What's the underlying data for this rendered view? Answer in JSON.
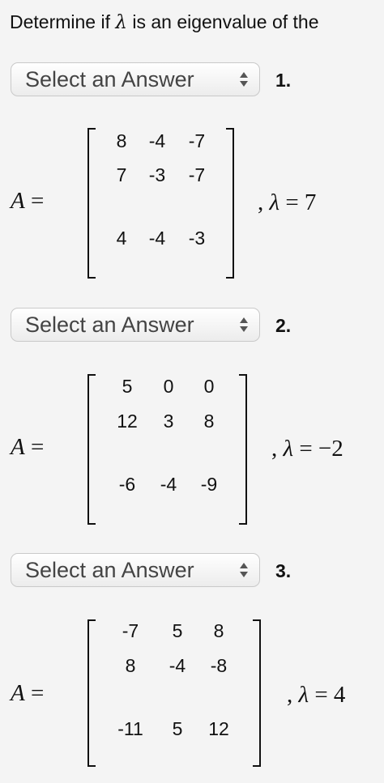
{
  "header": {
    "prefix": "Determine if ",
    "lambda": "λ",
    "suffix": " is an eigenvalue of the"
  },
  "problems": [
    {
      "select_value": "Select an Answer",
      "number": "1.",
      "a_label": "A",
      "equals": " =",
      "matrix": [
        [
          "8",
          "-4",
          "-7"
        ],
        [
          "7",
          "-3",
          "-7"
        ],
        [
          "4",
          "-4",
          "-3"
        ]
      ],
      "lambda_prefix": ", ",
      "lambda_symbol": "λ",
      "lambda_value": " = 7"
    },
    {
      "select_value": "Select an Answer",
      "number": "2.",
      "a_label": "A",
      "equals": " =",
      "matrix": [
        [
          "5",
          "0",
          "0"
        ],
        [
          "12",
          "3",
          "8"
        ],
        [
          "-6",
          "-4",
          "-9"
        ]
      ],
      "lambda_prefix": ", ",
      "lambda_symbol": "λ",
      "lambda_value": " = −2"
    },
    {
      "select_value": "Select an Answer",
      "number": "3.",
      "a_label": "A",
      "equals": " =",
      "matrix": [
        [
          "-7",
          "5",
          "8"
        ],
        [
          "8",
          "-4",
          "-8"
        ],
        [
          "-11",
          "5",
          "12"
        ]
      ],
      "lambda_prefix": ", ",
      "lambda_symbol": "λ",
      "lambda_value": " = 4"
    }
  ],
  "icons": {
    "select_arrows": "up-down-chevron-icon"
  }
}
